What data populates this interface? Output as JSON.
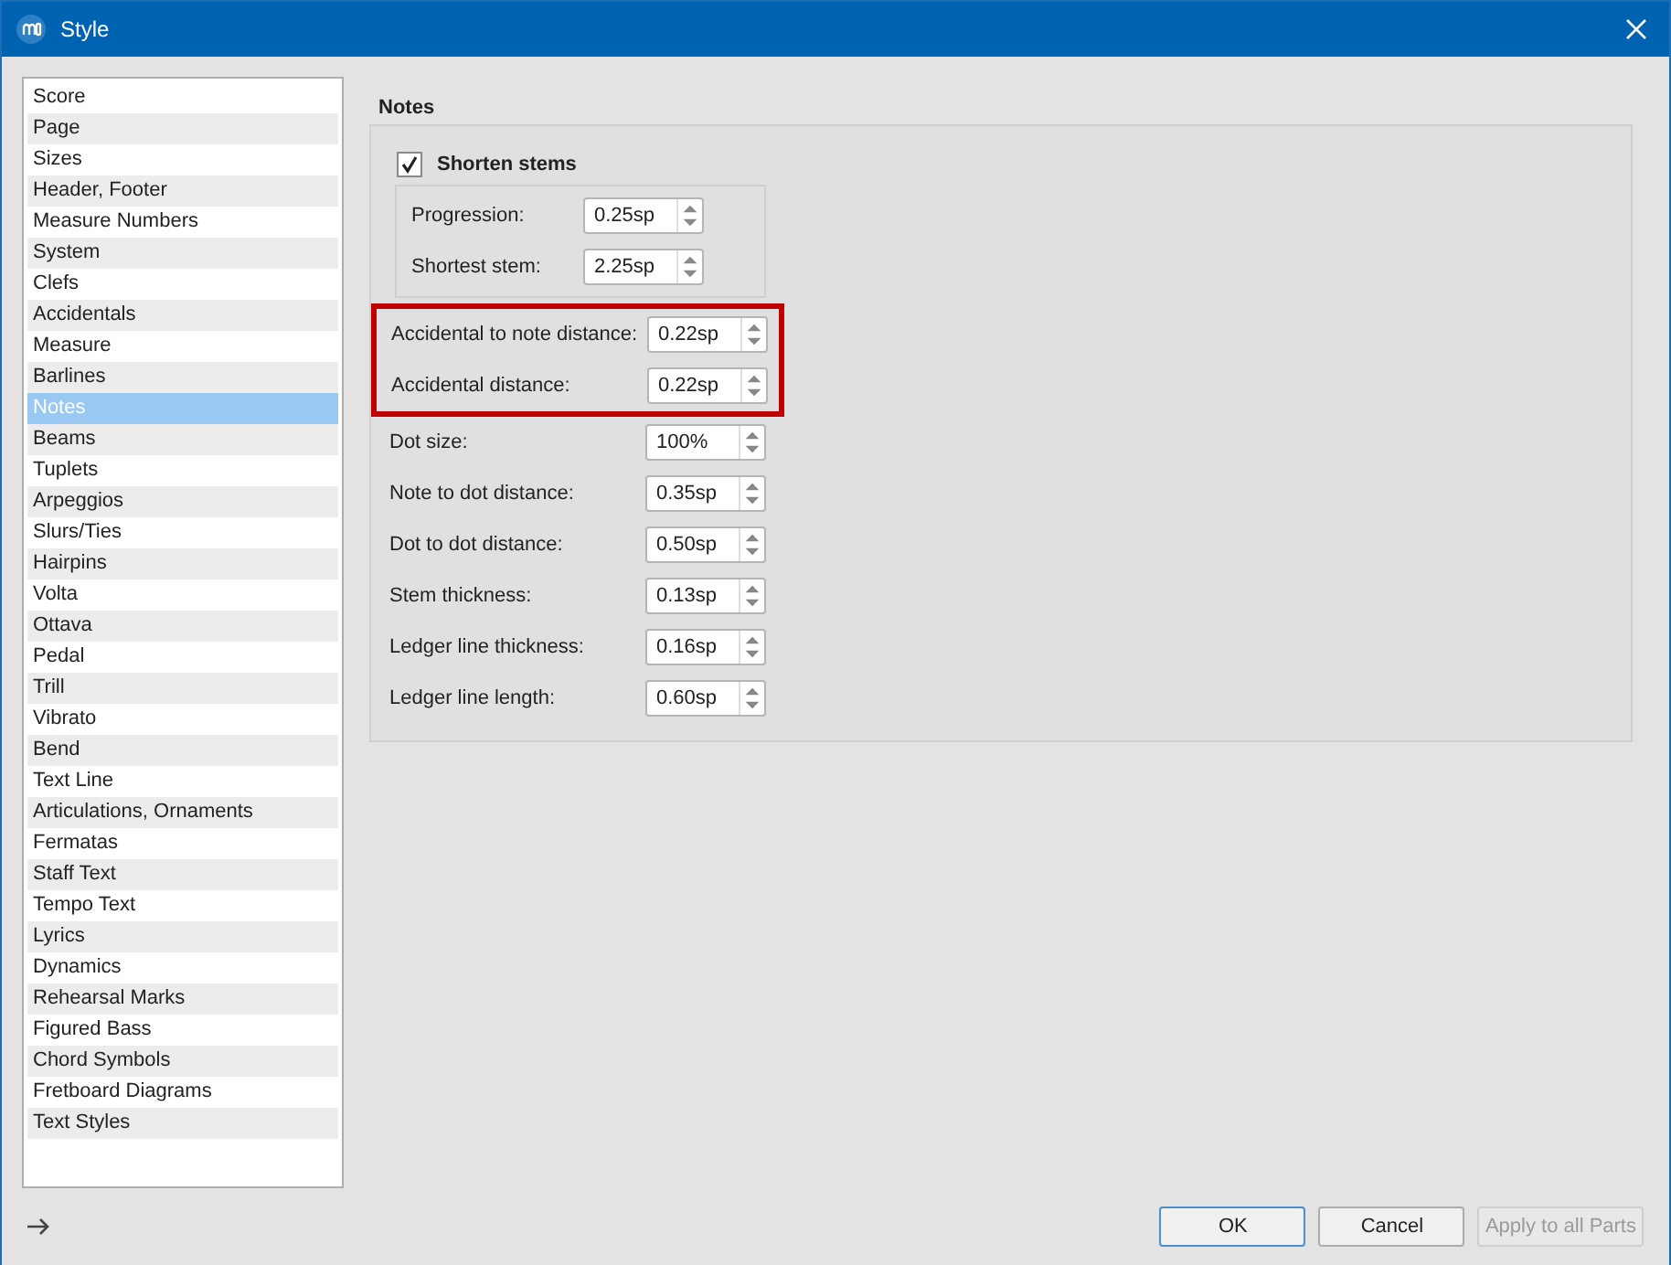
{
  "window": {
    "title": "Style"
  },
  "sidebar": {
    "items": [
      {
        "label": "Score",
        "selected": false
      },
      {
        "label": "Page",
        "selected": false
      },
      {
        "label": "Sizes",
        "selected": false
      },
      {
        "label": "Header, Footer",
        "selected": false
      },
      {
        "label": "Measure Numbers",
        "selected": false
      },
      {
        "label": "System",
        "selected": false
      },
      {
        "label": "Clefs",
        "selected": false
      },
      {
        "label": "Accidentals",
        "selected": false
      },
      {
        "label": "Measure",
        "selected": false
      },
      {
        "label": "Barlines",
        "selected": false
      },
      {
        "label": "Notes",
        "selected": true
      },
      {
        "label": "Beams",
        "selected": false
      },
      {
        "label": "Tuplets",
        "selected": false
      },
      {
        "label": "Arpeggios",
        "selected": false
      },
      {
        "label": "Slurs/Ties",
        "selected": false
      },
      {
        "label": "Hairpins",
        "selected": false
      },
      {
        "label": "Volta",
        "selected": false
      },
      {
        "label": "Ottava",
        "selected": false
      },
      {
        "label": "Pedal",
        "selected": false
      },
      {
        "label": "Trill",
        "selected": false
      },
      {
        "label": "Vibrato",
        "selected": false
      },
      {
        "label": "Bend",
        "selected": false
      },
      {
        "label": "Text Line",
        "selected": false
      },
      {
        "label": "Articulations, Ornaments",
        "selected": false
      },
      {
        "label": "Fermatas",
        "selected": false
      },
      {
        "label": "Staff Text",
        "selected": false
      },
      {
        "label": "Tempo Text",
        "selected": false
      },
      {
        "label": "Lyrics",
        "selected": false
      },
      {
        "label": "Dynamics",
        "selected": false
      },
      {
        "label": "Rehearsal Marks",
        "selected": false
      },
      {
        "label": "Figured Bass",
        "selected": false
      },
      {
        "label": "Chord Symbols",
        "selected": false
      },
      {
        "label": "Fretboard Diagrams",
        "selected": false
      },
      {
        "label": "Text Styles",
        "selected": false
      }
    ]
  },
  "notes": {
    "title": "Notes",
    "shorten_stems": {
      "label": "Shorten stems",
      "checked": true,
      "rows": [
        {
          "label": "Progression:",
          "value": "0.25sp"
        },
        {
          "label": "Shortest stem:",
          "value": "2.25sp"
        }
      ]
    },
    "highlighted_rows": [
      {
        "label": "Accidental to note distance:",
        "value": "0.22sp"
      },
      {
        "label": "Accidental distance:",
        "value": "0.22sp"
      }
    ],
    "rows": [
      {
        "label": "Dot size:",
        "value": "100%"
      },
      {
        "label": "Note to dot distance:",
        "value": "0.35sp"
      },
      {
        "label": "Dot to dot distance:",
        "value": "0.50sp"
      },
      {
        "label": "Stem thickness:",
        "value": "0.13sp"
      },
      {
        "label": "Ledger line thickness:",
        "value": "0.16sp"
      },
      {
        "label": "Ledger line length:",
        "value": "0.60sp"
      }
    ]
  },
  "buttons": [
    {
      "label": "OK",
      "disabled": false,
      "default": true
    },
    {
      "label": "Cancel",
      "disabled": false,
      "default": false
    },
    {
      "label": "Apply to all Parts",
      "disabled": true,
      "default": false
    }
  ]
}
